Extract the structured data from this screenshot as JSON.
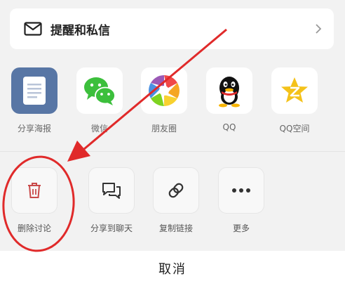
{
  "notify": {
    "label": "提醒和私信",
    "icon": "mail-icon",
    "chevron": "chevron-right-icon"
  },
  "share_targets": [
    {
      "label": "分享海报",
      "icon": "poster-icon"
    },
    {
      "label": "微信",
      "icon": "wechat-icon"
    },
    {
      "label": "朋友圈",
      "icon": "moments-icon"
    },
    {
      "label": "QQ",
      "icon": "qq-icon"
    },
    {
      "label": "QQ空间",
      "icon": "qzone-icon"
    }
  ],
  "actions": [
    {
      "label": "删除讨论",
      "icon": "trash-icon"
    },
    {
      "label": "分享到聊天",
      "icon": "chat-bubbles-icon"
    },
    {
      "label": "复制链接",
      "icon": "link-icon"
    },
    {
      "label": "更多",
      "icon": "more-icon"
    }
  ],
  "cancel_label": "取消",
  "colors": {
    "annotation_red": "#e02a2a",
    "trash_red": "#c94a4a",
    "wechat_green": "#3cbf3c",
    "poster_blue": "#5876a5",
    "qzone_yellow": "#f4c21a"
  }
}
